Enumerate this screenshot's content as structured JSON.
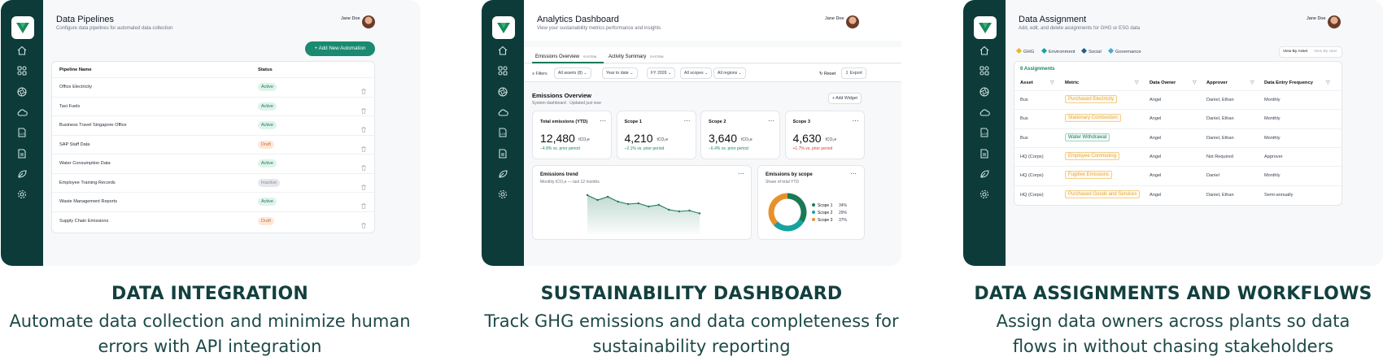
{
  "user": {
    "name": "Jane Doe"
  },
  "p1": {
    "title": "Data Pipelines",
    "subtitle": "Configure data pipelines for automated data collection",
    "add_button": "+ Add New Automation",
    "col_name": "Pipeline Name",
    "col_status": "Status",
    "rows": [
      {
        "name": "Office Electricity",
        "status": "Active"
      },
      {
        "name": "Taxi Fuels",
        "status": "Active"
      },
      {
        "name": "Business Travel Singapore Office",
        "status": "Active"
      },
      {
        "name": "SAP Staff Data",
        "status": "Draft"
      },
      {
        "name": "Water Consumption Data",
        "status": "Active"
      },
      {
        "name": "Employee Training Records",
        "status": "Inactive"
      },
      {
        "name": "Waste Management Reports",
        "status": "Active"
      },
      {
        "name": "Supply Chain Emissions",
        "status": "Draft"
      }
    ]
  },
  "p2": {
    "title": "Analytics Dashboard",
    "subtitle": "View your sustainability metrics performance and insights",
    "tab1": "Emissions Overview",
    "tab1_tag": "SYSTEM",
    "tab2": "Activity Summary",
    "tab2_tag": "SYSTEM",
    "filters_label": "Filters",
    "filter1": "All assets (8)",
    "filter2": "Year to date",
    "filter3": "FY 2026",
    "filter4": "All scopes",
    "filter5": "All regions",
    "reset": "Reset",
    "export": "Export",
    "section_title": "Emissions Overview",
    "section_sub": "System dashboard · Updated just now",
    "add_widget": "+ Add Widget",
    "kpis": [
      {
        "label": "Total emissions (YTD)",
        "value": "12,480",
        "unit": "tCO₂e",
        "delta": "−4.8% vs. prior period",
        "color": "#1a8a5a"
      },
      {
        "label": "Scope 1",
        "value": "4,210",
        "unit": "tCO₂e",
        "delta": "−2.1% vs. prior period",
        "color": "#1a8a5a"
      },
      {
        "label": "Scope 2",
        "value": "3,640",
        "unit": "tCO₂e",
        "delta": "−6.4% vs. prior period",
        "color": "#1a8a5a"
      },
      {
        "label": "Scope 3",
        "value": "4,630",
        "unit": "tCO₂e",
        "delta": "+1.7% vs. prior period",
        "color": "#d93b3b"
      }
    ],
    "trend_title": "Emissions trend",
    "trend_sub": "Monthly tCO₂e — last 12 months",
    "scope_title": "Emissions by scope",
    "scope_sub": "Share of total YTD",
    "chart_data": [
      {
        "type": "area",
        "title": "Emissions trend",
        "x": [
          1,
          2,
          3,
          4,
          5,
          6,
          7,
          8,
          9,
          10,
          11,
          12
        ],
        "values": [
          1180,
          1120,
          1160,
          1100,
          1070,
          1080,
          1040,
          1060,
          1000,
          980,
          990,
          955
        ],
        "ylim": [
          700,
          1220
        ],
        "color": "#1f7a5a"
      },
      {
        "type": "pie",
        "title": "Emissions by scope",
        "categories": [
          "Scope 1",
          "Scope 2",
          "Scope 3"
        ],
        "values": [
          34,
          29,
          37
        ],
        "labels": [
          "34%",
          "29%",
          "37%"
        ],
        "colors": [
          "#1a7a55",
          "#17a2a0",
          "#e8912b"
        ]
      }
    ]
  },
  "p3": {
    "title": "Data Assignment",
    "subtitle": "Add, edit, and delete assignments for GHG or ESG data",
    "legend": [
      {
        "label": "GHG",
        "color": "#f0b323"
      },
      {
        "label": "Environment",
        "color": "#17a2a0"
      },
      {
        "label": "Social",
        "color": "#1f5f8b"
      },
      {
        "label": "Governance",
        "color": "#4fa3d9"
      }
    ],
    "view_asset": "View By Asset",
    "view_user": "View By User",
    "count": "6 Assignments",
    "cols": [
      "Asset",
      "Metric",
      "Data Owner",
      "Approver",
      "Data Entry Frequency"
    ],
    "rows": [
      {
        "asset": "Bus",
        "metric": "Purchased Electricity",
        "mcolor": "or",
        "owner": "Angel",
        "approver": "Daniel, Ethan",
        "freq": "Monthly"
      },
      {
        "asset": "Bus",
        "metric": "Stationary Combustion",
        "mcolor": "or",
        "owner": "Angel",
        "approver": "Daniel, Ethan",
        "freq": "Monthly"
      },
      {
        "asset": "Bus",
        "metric": "Water Withdrawal",
        "mcolor": "gr",
        "owner": "Angel",
        "approver": "Daniel, Ethan",
        "freq": "Monthly"
      },
      {
        "asset": "HQ (Corps)",
        "metric": "Employee Commuting",
        "mcolor": "or",
        "owner": "Angel",
        "approver": "Not Required",
        "freq": "Approver"
      },
      {
        "asset": "HQ (Corps)",
        "metric": "Fugitive Emissions",
        "mcolor": "or",
        "owner": "Angel",
        "approver": "Daniel",
        "freq": "Monthly"
      },
      {
        "asset": "HQ (Corps)",
        "metric": "Purchased Goods and Services",
        "mcolor": "or",
        "owner": "Angel",
        "approver": "Daniel, Ethan",
        "freq": "Semi-annually"
      }
    ]
  },
  "captions": [
    {
      "title": "DATA INTEGRATION",
      "l1": "Automate data collection and minimize human",
      "l2": "errors with API integration"
    },
    {
      "title": "SUSTAINABILITY DASHBOARD",
      "l1": "Track GHG emissions and data completeness for",
      "l2": "sustainability reporting"
    },
    {
      "title": "DATA ASSIGNMENTS AND WORKFLOWS",
      "l1": "Assign data owners across plants so data",
      "l2": "flows in without chasing stakeholders"
    }
  ]
}
